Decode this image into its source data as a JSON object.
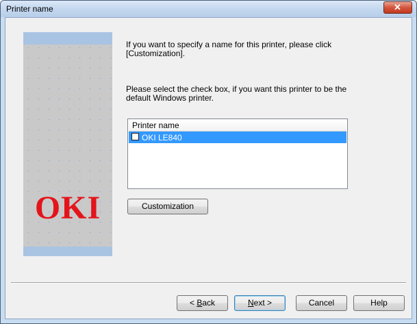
{
  "window": {
    "title": "Printer name",
    "close_glyph": "✕"
  },
  "banner": {
    "logo_text": "OKI",
    "logo_color": "#e3151b"
  },
  "content": {
    "intro_text": "If you want to specify a name for this printer, please click [Customization].",
    "default_text": "Please select the check box, if you want this printer to be the default Windows printer."
  },
  "printer_list": {
    "header": "Printer name",
    "items": [
      {
        "name": "OKI LE840",
        "checked": false,
        "selected": true
      }
    ]
  },
  "buttons": {
    "customization": "Customization",
    "back_key": "B",
    "back_rest": "ack",
    "next_key": "N",
    "next_rest": "ext >",
    "cancel": "Cancel",
    "help": "Help"
  },
  "colors": {
    "selection": "#3399ff",
    "banner_accent": "#a9c3e3"
  }
}
